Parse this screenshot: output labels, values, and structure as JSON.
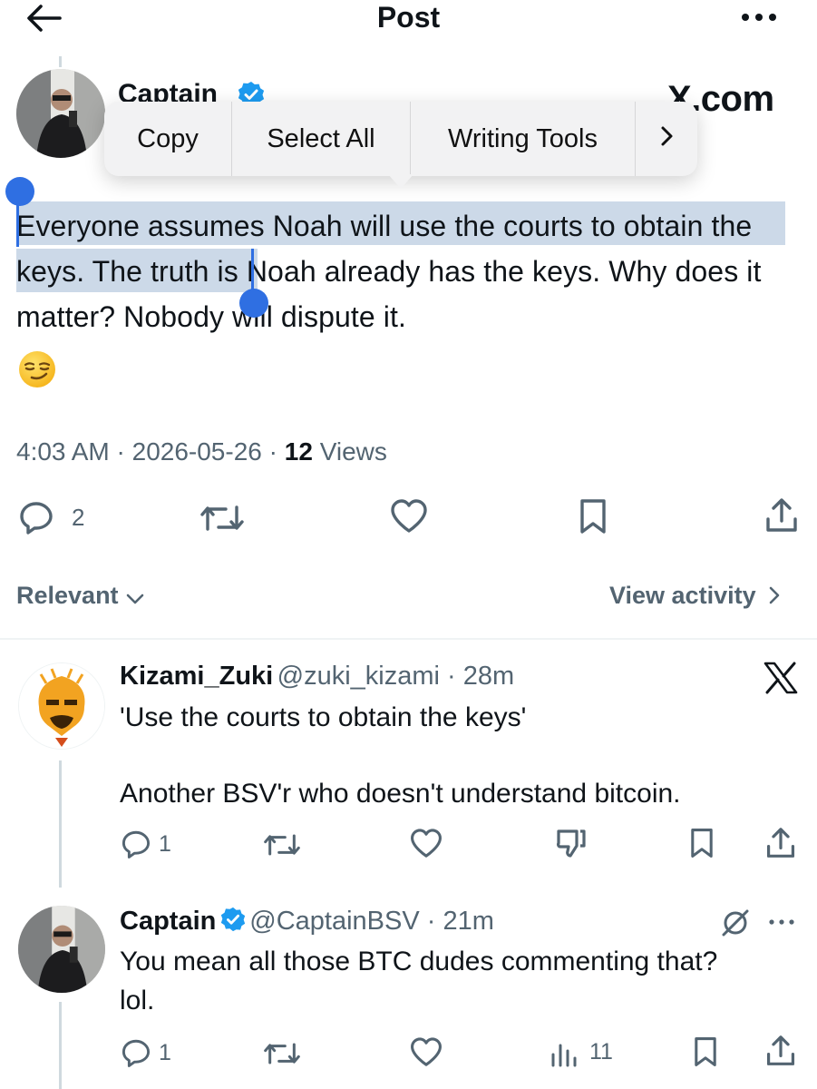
{
  "header": {
    "title": "Post"
  },
  "post": {
    "author_name": "Captain",
    "watermark": "X.com",
    "text": "Everyone assumes Noah will use the courts to obtain the keys. The truth is Noah already has the keys. Why does it matter? Nobody will dispute it.",
    "emoji": "smirking-face",
    "time": "4:03 AM",
    "date": "2026-05-26",
    "views_count": "12",
    "views_label": "Views",
    "replies": "2"
  },
  "context_menu": {
    "items": [
      "Copy",
      "Select All",
      "Writing Tools"
    ]
  },
  "sort": {
    "label": "Relevant",
    "view_activity": "View activity"
  },
  "replies": [
    {
      "name": "Kizami_Zuki",
      "handle": "@zuki_kizami",
      "time": "28m",
      "line1": "'Use the courts to obtain the keys'",
      "line2": "Another BSV'r who doesn't understand bitcoin.",
      "reply_count": "1"
    },
    {
      "name": "Captain",
      "handle": "@CaptainBSV",
      "time": "21m",
      "line1": "You mean all those BTC dudes commenting that?",
      "line2": "lol.",
      "reply_count": "1",
      "views": "11"
    }
  ],
  "colors": {
    "accent": "#1d9bf0",
    "selection": "#ccd9e8",
    "handle": "#2f6fe2",
    "muted": "#536471"
  }
}
